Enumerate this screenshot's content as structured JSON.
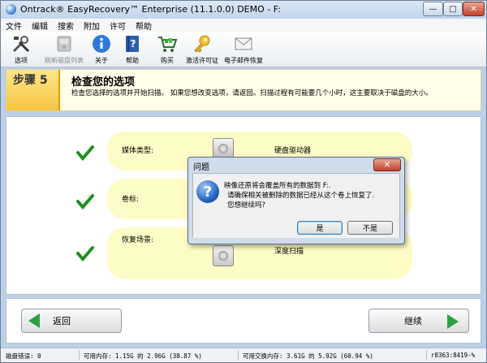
{
  "window": {
    "title": "Ontrack® EasyRecovery™ Enterprise (11.1.0.0) DEMO - F:",
    "minimize": "—",
    "maximize": "□",
    "close": "✕"
  },
  "menu": [
    "文件",
    "编辑",
    "搜索",
    "附加",
    "许可",
    "帮助"
  ],
  "toolbar": [
    {
      "label": "选项",
      "icon": "tools-icon",
      "enabled": true
    },
    {
      "label": "刷新磁盘列表",
      "icon": "refresh-disk-icon",
      "enabled": false
    },
    {
      "label": "关于",
      "icon": "info-icon",
      "enabled": true
    },
    {
      "label": "帮助",
      "icon": "help-book-icon",
      "enabled": true
    },
    {
      "label": "购买",
      "icon": "shopping-cart-icon",
      "enabled": true
    },
    {
      "label": "激活许可证",
      "icon": "key-icon",
      "enabled": true
    },
    {
      "label": "电子邮件恢复",
      "icon": "mail-icon",
      "enabled": true
    }
  ],
  "header": {
    "step": "步骤  5",
    "title": "检查您的选项",
    "description": "检查您选择的选项并开始扫描。 如果您想改变选项，请返回。扫描过程有可能要几个小时，这主要取决于磁盘的大小。"
  },
  "summary": [
    {
      "label": "媒体类型:",
      "value": "硬盘驱动器"
    },
    {
      "label": "卷标:",
      "value": ""
    },
    {
      "label": "恢复场景:",
      "value": "深度扫描"
    }
  ],
  "nav": {
    "back": "返回",
    "next": "继续"
  },
  "status": {
    "disk_errors": "磁盘错误: 0",
    "memory": "可用内存: 1.15G 的 2.96G (38.87 %)",
    "swap": "可用交换内存: 3.61G 的 5.92G (60.94 %)",
    "build": "r8363:8419-%"
  },
  "dialog": {
    "title": "问题",
    "close": "✕",
    "lines": [
      "映像还原将会覆盖所有的数据到 F:.",
      "请确保相关被删除的数据已经从这个卷上恢复了.",
      "您想继续吗?"
    ],
    "yes": "是",
    "no": "不是"
  }
}
